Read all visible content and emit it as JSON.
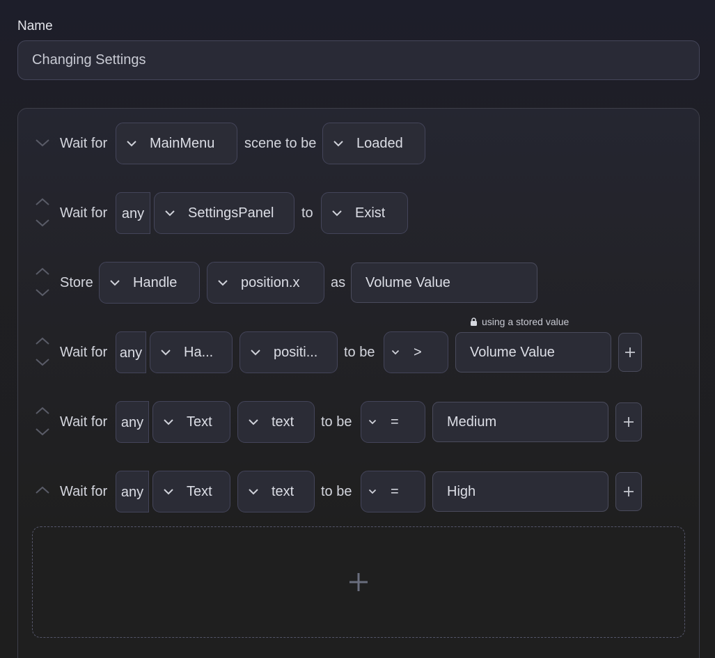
{
  "name_field": {
    "label": "Name",
    "value": "Changing Settings"
  },
  "steps": [
    {
      "arrows": "down",
      "text_1": "Wait for",
      "scene_select": "MainMenu",
      "text_2": "scene to be",
      "state_select": "Loaded"
    },
    {
      "arrows": "up-down",
      "text_1": "Wait for",
      "quantifier": "any",
      "object_select": "SettingsPanel",
      "text_2": "to",
      "state_select": "Exist"
    },
    {
      "arrows": "up-down",
      "text_1": "Store",
      "object_select": "Handle",
      "property_select": "position.x",
      "text_2": "as",
      "variable_name": "Volume Value"
    },
    {
      "arrows": "up-down",
      "text_1": "Wait for",
      "quantifier": "any",
      "object_select": "Ha...",
      "property_select": "positi...",
      "text_2": "to be",
      "operator_select": ">",
      "value": "Volume Value",
      "hint": "using a stored value",
      "add_label": "+"
    },
    {
      "arrows": "up-down",
      "text_1": "Wait for",
      "quantifier": "any",
      "object_select": "Text",
      "property_select": "text",
      "text_2": "to be",
      "operator_select": "=",
      "value": "Medium",
      "add_label": "+"
    },
    {
      "arrows": "up",
      "text_1": "Wait for",
      "quantifier": "any",
      "object_select": "Text",
      "property_select": "text",
      "text_2": "to be",
      "operator_select": "=",
      "value": "High",
      "add_label": "+"
    }
  ],
  "icons": {
    "chevron_down": "chevron-down-icon",
    "chevron_up": "chevron-up-icon",
    "lock": "lock-icon",
    "plus": "plus-icon"
  },
  "colors": {
    "background": "#1e1e1e",
    "panel": "#232329",
    "field": "#2b2c36",
    "border": "#44455a",
    "text": "#dcdee6",
    "muted_icon": "#5a5c68",
    "add_icon": "#6a6e7e"
  }
}
